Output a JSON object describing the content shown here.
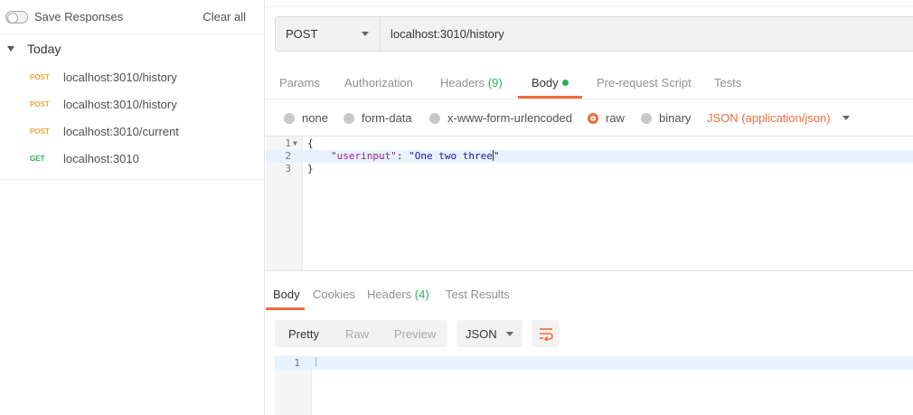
{
  "sidebar": {
    "save_responses_label": "Save Responses",
    "clear_all_label": "Clear all",
    "group_label": "Today",
    "history": [
      {
        "method": "POST",
        "url": "localhost:3010/history"
      },
      {
        "method": "POST",
        "url": "localhost:3010/history"
      },
      {
        "method": "POST",
        "url": "localhost:3010/current"
      },
      {
        "method": "GET",
        "url": "localhost:3010"
      }
    ]
  },
  "request": {
    "method": "POST",
    "url": "localhost:3010/history",
    "tabs": {
      "params": "Params",
      "authorization": "Authorization",
      "headers": "Headers",
      "headers_count": "(9)",
      "body": "Body",
      "pre_request": "Pre-request Script",
      "tests": "Tests"
    },
    "body_options": {
      "none": "none",
      "form_data": "form-data",
      "urlencoded": "x-www-form-urlencoded",
      "raw": "raw",
      "binary": "binary",
      "content_type": "JSON (application/json)"
    },
    "editor": {
      "line_numbers": [
        "1",
        "2",
        "3"
      ],
      "line1": "{",
      "line2_key": "\"userinput\"",
      "line2_sep": ": ",
      "line2_value": "\"One two three",
      "line2_value_end": "\"",
      "line3": "}"
    }
  },
  "response": {
    "tabs": {
      "body": "Body",
      "cookies": "Cookies",
      "headers": "Headers",
      "headers_count": "(4)",
      "test_results": "Test Results"
    },
    "view_modes": {
      "pretty": "Pretty",
      "raw": "Raw",
      "preview": "Preview"
    },
    "format": "JSON",
    "editor": {
      "line_numbers": [
        "1"
      ]
    }
  },
  "colors": {
    "accent": "#f26b3a",
    "post_method": "#f5a623",
    "get_method": "#27ae60",
    "count_green": "#27ae60"
  }
}
